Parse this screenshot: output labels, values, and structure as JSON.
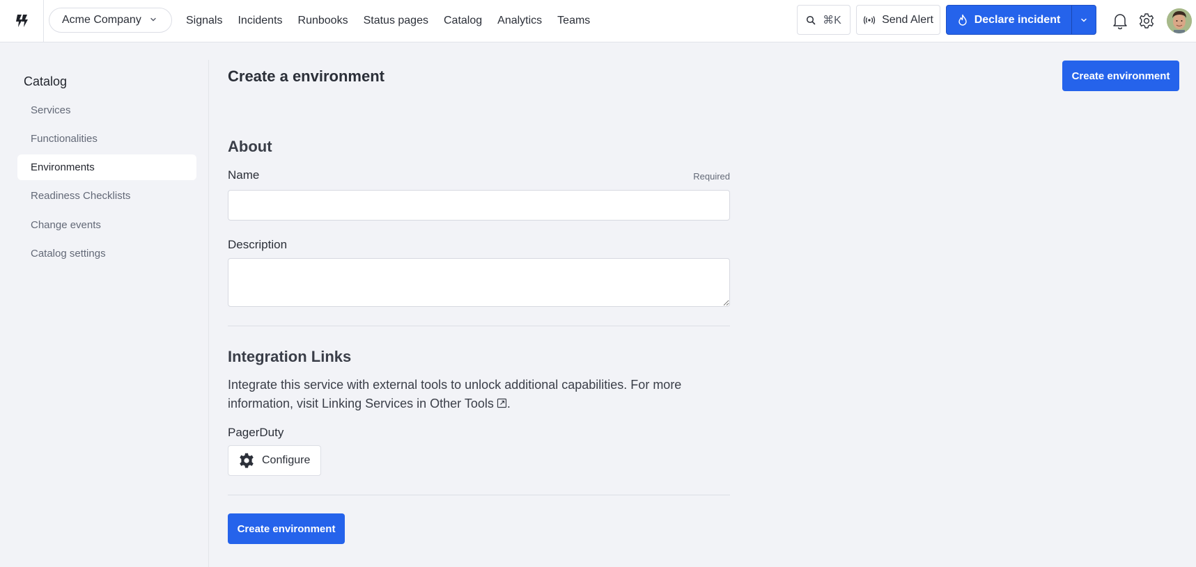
{
  "header": {
    "org_name": "Acme Company",
    "nav": [
      "Signals",
      "Incidents",
      "Runbooks",
      "Status pages",
      "Catalog",
      "Analytics",
      "Teams"
    ],
    "search_shortcut": "⌘K",
    "send_alert_label": "Send Alert",
    "declare_incident_label": "Declare incident",
    "icons": [
      "logo-icon",
      "chevron-down-icon",
      "search-icon",
      "broadcast-icon",
      "flame-icon",
      "bell-icon",
      "gear-icon",
      "avatar"
    ]
  },
  "sidebar": {
    "title": "Catalog",
    "items": [
      {
        "label": "Services",
        "active": false
      },
      {
        "label": "Functionalities",
        "active": false
      },
      {
        "label": "Environments",
        "active": true
      },
      {
        "label": "Readiness Checklists",
        "active": false
      },
      {
        "label": "Change events",
        "active": false
      },
      {
        "label": "Catalog settings",
        "active": false
      }
    ]
  },
  "main": {
    "title": "Create a environment",
    "create_button_label": "Create environment",
    "about_heading": "About",
    "name_label": "Name",
    "name_required": "Required",
    "name_value": "",
    "description_label": "Description",
    "description_value": "",
    "integration_heading": "Integration Links",
    "integration_text_before": "Integrate this service with external tools to unlock additional capabilities. For more information, visit ",
    "integration_link_text": "Linking Services in Other Tools",
    "integration_text_after": ".",
    "pagerduty_label": "PagerDuty",
    "configure_label": "Configure",
    "submit_label": "Create environment"
  },
  "colors": {
    "primary": "#2563eb",
    "background": "#f2f3f7",
    "surface": "#ffffff",
    "text": "#2b2f38",
    "muted_text": "#636977"
  }
}
